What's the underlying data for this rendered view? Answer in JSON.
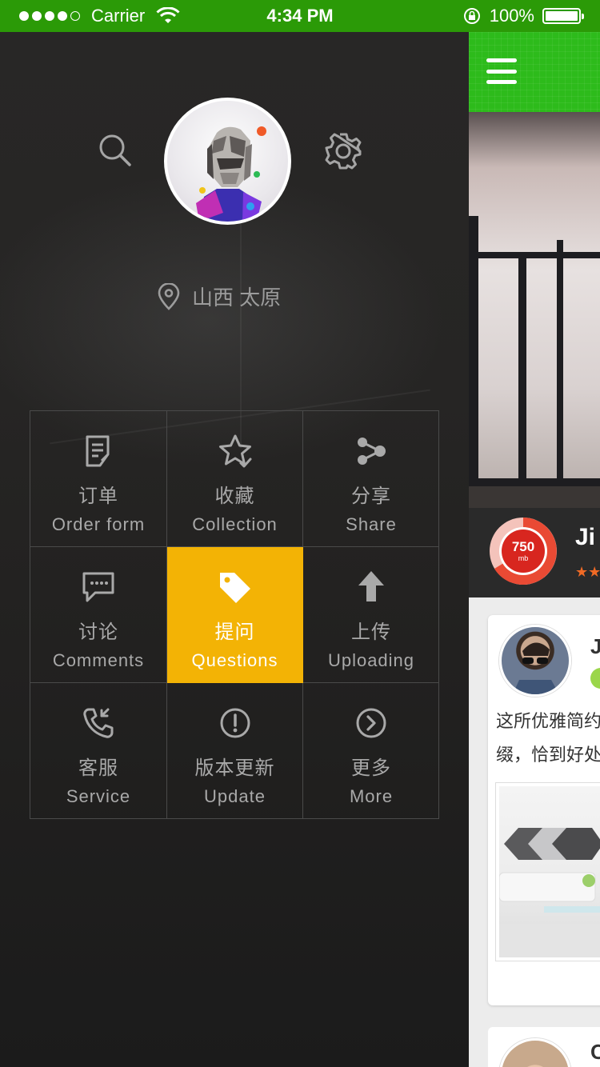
{
  "status_bar": {
    "carrier": "Carrier",
    "time": "4:34 PM",
    "battery": "100%",
    "signal_strength": "4 of 5",
    "background_color": "#2b9a07"
  },
  "drawer": {
    "location": "山西 太原",
    "menu": [
      {
        "zh": "订单",
        "en": "Order form",
        "icon": "order-icon",
        "active": false
      },
      {
        "zh": "收藏",
        "en": "Collection",
        "icon": "star-icon",
        "active": false
      },
      {
        "zh": "分享",
        "en": "Share",
        "icon": "share-icon",
        "active": false
      },
      {
        "zh": "讨论",
        "en": "Comments",
        "icon": "comment-icon",
        "active": false
      },
      {
        "zh": "提问",
        "en": "Questions",
        "icon": "tag-icon",
        "active": true
      },
      {
        "zh": "上传",
        "en": "Uploading",
        "icon": "upload-icon",
        "active": false
      },
      {
        "zh": "客服",
        "en": "Service",
        "icon": "phone-icon",
        "active": false
      },
      {
        "zh": "版本更新",
        "en": "Update",
        "icon": "alert-icon",
        "active": false
      },
      {
        "zh": "更多",
        "en": "More",
        "icon": "chevron-right-icon",
        "active": false
      }
    ],
    "active_color": "#f3b305"
  },
  "panel": {
    "header_color": "#2dbb1b",
    "gauge": {
      "value": "750",
      "unit": "mb"
    },
    "hero_title": "Ji",
    "rating_stars": "★★",
    "card": {
      "name": "J",
      "text_lines": [
        "这所优雅简约",
        "缀，恰到好处"
      ]
    },
    "card2": {
      "name": "C"
    }
  }
}
